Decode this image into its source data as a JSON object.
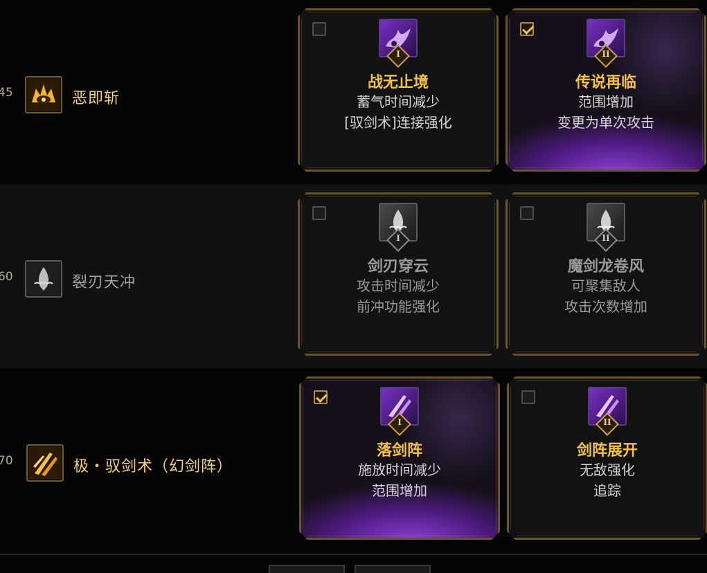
{
  "skills": [
    {
      "level": "45",
      "name": "恶即斩",
      "name_color": "gold",
      "icon": "golden-blade-eye-icon",
      "options": [
        {
          "tier": "I",
          "title": "战无止境",
          "lines": [
            "蓄气时间减少",
            "[驭剑术]连接强化"
          ],
          "selected": false,
          "icon": "purple-burst-icon"
        },
        {
          "tier": "II",
          "title": "传说再临",
          "lines": [
            "范围增加",
            "变更为单次攻击"
          ],
          "selected": true,
          "icon": "purple-burst-icon"
        }
      ]
    },
    {
      "level": "60",
      "name": "裂刃天冲",
      "name_color": "grey",
      "icon": "rising-blade-icon",
      "options": [
        {
          "tier": "I",
          "title": "剑刃穿云",
          "lines": [
            "攻击时间减少",
            "前冲功能强化"
          ],
          "selected": false,
          "icon": "silver-flame-icon"
        },
        {
          "tier": "II",
          "title": "魔剑龙卷风",
          "lines": [
            "可聚集敌人",
            "攻击次数增加"
          ],
          "selected": false,
          "icon": "silver-flame-icon"
        }
      ]
    },
    {
      "level": "70",
      "name": "极・驭剑术（幻剑阵）",
      "name_color": "gold",
      "icon": "sword-rain-icon",
      "options": [
        {
          "tier": "I",
          "title": "落剑阵",
          "lines": [
            "施放时间减少",
            "范围增加"
          ],
          "selected": true,
          "icon": "purple-sword-strike-icon"
        },
        {
          "tier": "II",
          "title": "剑阵展开",
          "lines": [
            "无敌强化",
            "追踪"
          ],
          "selected": false,
          "icon": "purple-sword-strike-icon"
        }
      ]
    }
  ],
  "colors": {
    "gold_text": "#f2c24a",
    "grey_text": "#9a9a9a",
    "selected_glow": "#9b46eb",
    "card_border": "#6a5430"
  }
}
